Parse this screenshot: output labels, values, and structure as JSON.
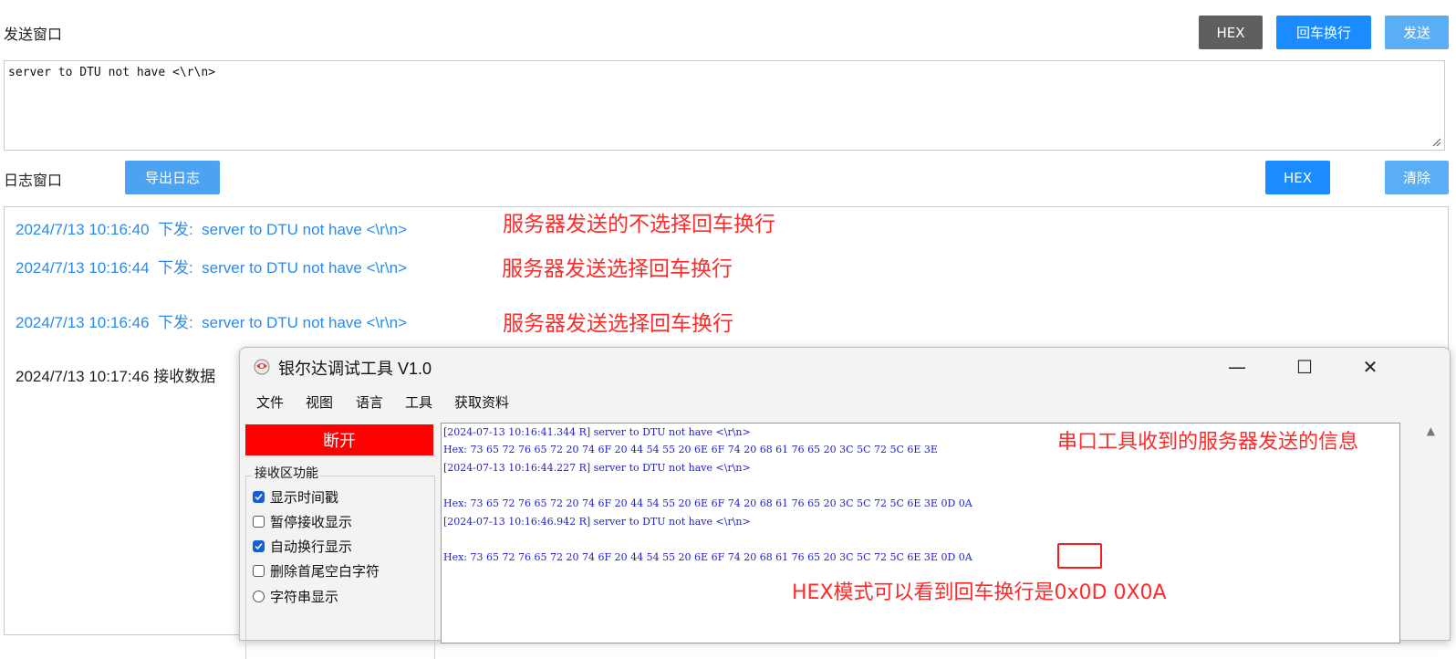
{
  "send_panel": {
    "title": "发送窗口",
    "hex_label": "HEX",
    "crlf_label": "回车换行",
    "send_label": "发送",
    "text": "server to DTU not have <\\r\\n>"
  },
  "log_panel": {
    "title": "日志窗口",
    "export_label": "导出日志",
    "hex_label": "HEX",
    "clear_label": "清除",
    "lines": [
      "2024/7/13 10:16:40  下发:  server to DTU not have <\\r\\n>",
      "2024/7/13 10:16:44  下发:  server to DTU not have <\\r\\n>",
      "2024/7/13 10:16:46  下发:  server to DTU not have <\\r\\n>",
      "2024/7/13 10:17:46 接收数据"
    ]
  },
  "annotations": {
    "a1": "服务器发送的不选择回车换行",
    "a2": "服务器发送选择回车换行",
    "a3": "服务器发送选择回车换行",
    "a4": "串口工具收到的服务器发送的信息",
    "a5": "HEX模式可以看到回车换行是0x0D 0X0A"
  },
  "tool_window": {
    "title": "银尔达调试工具 V1.0",
    "minimize": "—",
    "maximize": "☐",
    "close": "✕",
    "menu": [
      "文件",
      "视图",
      "语言",
      "工具",
      "获取资料"
    ],
    "disconnect_label": "断开",
    "receive_group": "接收区功能",
    "options": [
      {
        "label": "显示时间戳",
        "checked": true
      },
      {
        "label": "暂停接收显示",
        "checked": false
      },
      {
        "label": "自动换行显示",
        "checked": true
      },
      {
        "label": "删除首尾空白字符",
        "checked": false
      }
    ],
    "radio_label": "字符串显示",
    "receive_lines": [
      "[2024-07-13 10:16:41.344 R] server to DTU not have <\\r\\n>",
      "Hex: 73 65 72 76 65 72 20 74 6F 20 44 54 55 20 6E 6F 74 20 68 61 76 65 20 3C 5C 72 5C 6E 3E",
      "[2024-07-13 10:16:44.227 R] server to DTU not have <\\r\\n>",
      "Hex: 73 65 72 76 65 72 20 74 6F 20 44 54 55 20 6E 6F 74 20 68 61 76 65 20 3C 5C 72 5C 6E 3E 0D 0A",
      "[2024-07-13 10:16:46.942 R] server to DTU not have <\\r\\n>",
      "Hex: 73 65 72 76 65 72 20 74 6F 20 44 54 55 20 6E 6F 74 20 68 61 76 65 20 3C 5C 72 5C 6E 3E 0D 0A"
    ]
  },
  "colors": {
    "accent": "#1a8cff",
    "annotation": "#ff2a2a",
    "log_text": "#2d8ae6",
    "disconnect": "#ff0000"
  }
}
